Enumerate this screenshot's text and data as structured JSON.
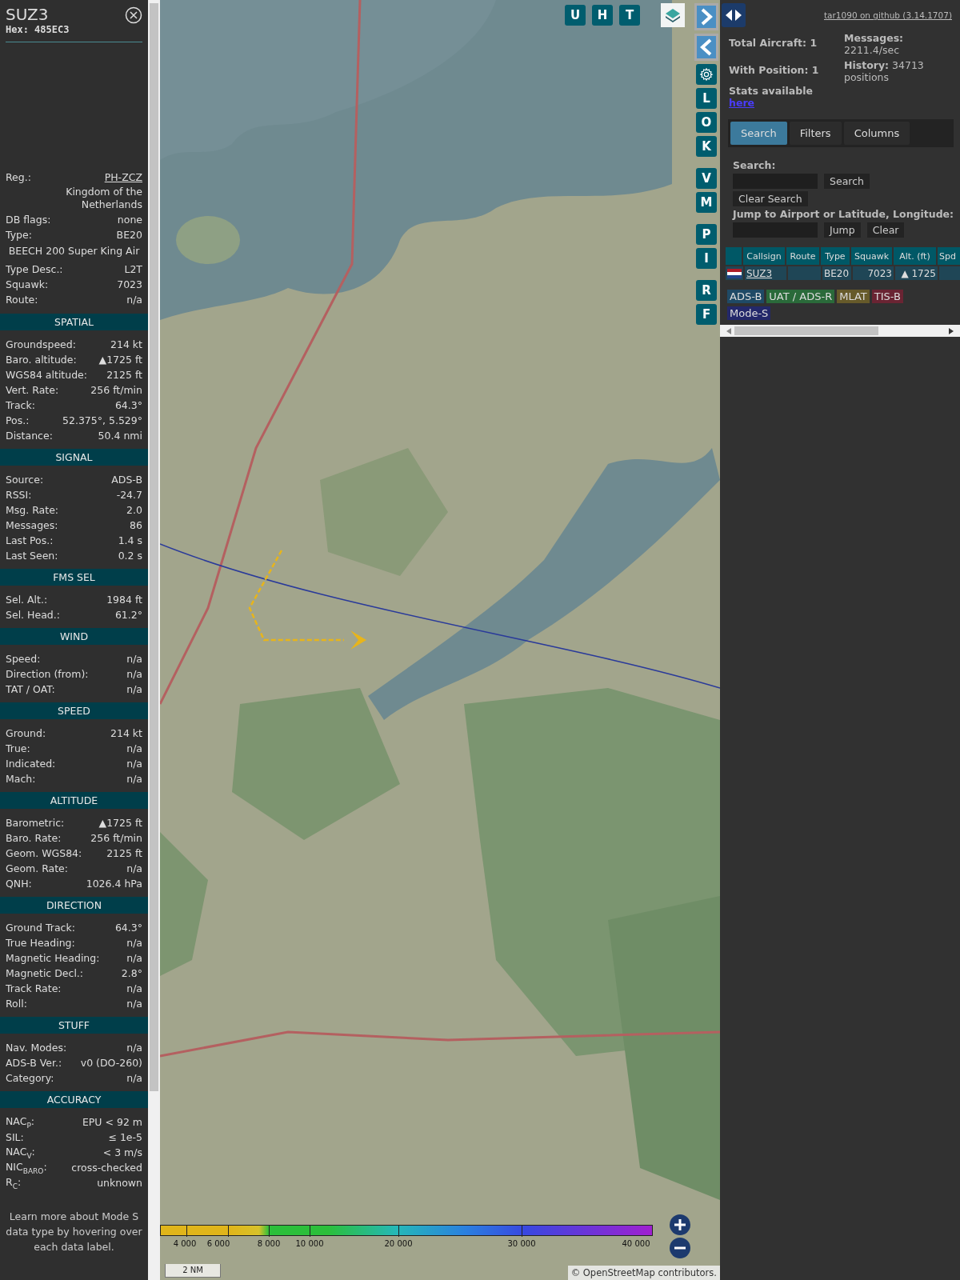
{
  "detail": {
    "callsign": "SUZ3",
    "hex": "Hex: 485EC3",
    "info": [
      {
        "kind": "link",
        "label": "Reg.:",
        "value": "PH-ZCZ"
      },
      {
        "kind": "note",
        "value": "Kingdom of the Netherlands"
      },
      {
        "kind": "pair",
        "label": "DB flags:",
        "value": "none"
      },
      {
        "kind": "pair",
        "label": "Type:",
        "value": "BE20"
      },
      {
        "kind": "full",
        "value": "BEECH 200 Super King Air"
      },
      {
        "kind": "pair",
        "label": "Type Desc.:",
        "value": "L2T"
      },
      {
        "kind": "pair",
        "label": "Squawk:",
        "value": "7023"
      },
      {
        "kind": "pair",
        "label": "Route:",
        "value": "n/a"
      }
    ],
    "sections": [
      {
        "title": "SPATIAL",
        "rows": [
          {
            "label": "Groundspeed:",
            "value": "214 kt"
          },
          {
            "label": "Baro. altitude:",
            "value": "▲1725 ft"
          },
          {
            "label": "WGS84 altitude:",
            "value": "2125 ft"
          },
          {
            "label": "Vert. Rate:",
            "value": "256 ft/min"
          },
          {
            "label": "Track:",
            "value": "64.3°"
          },
          {
            "label": "Pos.:",
            "value": "52.375°, 5.529°"
          },
          {
            "label": "Distance:",
            "value": "50.4 nmi"
          }
        ]
      },
      {
        "title": "SIGNAL",
        "rows": [
          {
            "label": "Source:",
            "value": "ADS-B"
          },
          {
            "label": "RSSI:",
            "value": "-24.7"
          },
          {
            "label": "Msg. Rate:",
            "value": "2.0"
          },
          {
            "label": "Messages:",
            "value": "86"
          },
          {
            "label": "Last Pos.:",
            "value": "1.4 s"
          },
          {
            "label": "Last Seen:",
            "value": "0.2 s"
          }
        ]
      },
      {
        "title": "FMS SEL",
        "rows": [
          {
            "label": "Sel. Alt.:",
            "value": "1984 ft"
          },
          {
            "label": "Sel. Head.:",
            "value": "61.2°"
          }
        ]
      },
      {
        "title": "WIND",
        "rows": [
          {
            "label": "Speed:",
            "value": "n/a"
          },
          {
            "label": "Direction (from):",
            "value": "n/a"
          },
          {
            "label": "TAT / OAT:",
            "value": "n/a"
          }
        ]
      },
      {
        "title": "SPEED",
        "rows": [
          {
            "label": "Ground:",
            "value": "214 kt"
          },
          {
            "label": "True:",
            "value": "n/a"
          },
          {
            "label": "Indicated:",
            "value": "n/a"
          },
          {
            "label": "Mach:",
            "value": "n/a"
          }
        ]
      },
      {
        "title": "ALTITUDE",
        "rows": [
          {
            "label": "Barometric:",
            "value": "▲1725 ft"
          },
          {
            "label": "Baro. Rate:",
            "value": "256 ft/min"
          },
          {
            "label": "Geom. WGS84:",
            "value": "2125 ft"
          },
          {
            "label": "Geom. Rate:",
            "value": "n/a"
          },
          {
            "label": "QNH:",
            "value": "1026.4 hPa"
          }
        ]
      },
      {
        "title": "DIRECTION",
        "rows": [
          {
            "label": "Ground Track:",
            "value": "64.3°"
          },
          {
            "label": "True Heading:",
            "value": "n/a"
          },
          {
            "label": "Magnetic Heading:",
            "value": "n/a"
          },
          {
            "label": "Magnetic Decl.:",
            "value": "2.8°"
          },
          {
            "label": "Track Rate:",
            "value": "n/a"
          },
          {
            "label": "Roll:",
            "value": "n/a"
          }
        ]
      },
      {
        "title": "STUFF",
        "rows": [
          {
            "label": "Nav. Modes:",
            "value": "n/a"
          },
          {
            "label": "ADS-B Ver.:",
            "value": "v0 (DO-260)"
          },
          {
            "label": "Category:",
            "value": "n/a"
          }
        ]
      },
      {
        "title": "ACCURACY",
        "rows": [
          {
            "label": "NAC$_{P}$:",
            "value": "EPU < 92 m"
          },
          {
            "label": "SIL:",
            "value": "≤ 1e-5"
          },
          {
            "label": "NAC$_{V}$:",
            "value": "< 3 m/s"
          },
          {
            "label": "NIC$_{BARO}$:",
            "value": "cross-checked"
          },
          {
            "label": "R$_{C}$:",
            "value": "unknown"
          }
        ]
      }
    ],
    "footer": "Learn more about Mode S data type by hovering over each data label."
  },
  "map": {
    "top_buttons": [
      "U",
      "H",
      "T"
    ],
    "side_groups": [
      [
        "L",
        "O",
        "K"
      ],
      [
        "V",
        "M"
      ],
      [
        "P",
        "I"
      ],
      [
        "R",
        "F"
      ]
    ],
    "legend": [
      "4 000",
      "6 000",
      "8 000",
      "10 000",
      "20 000",
      "30 000",
      "40 000"
    ],
    "scale": "2 NM",
    "attribution": {
      "prefix": "©",
      "link": "OpenStreetMap",
      "suffix": "contributors."
    }
  },
  "panel": {
    "version_link": "tar1090 on github (3.14.1707)",
    "stats_left": [
      "Total Aircraft: 1",
      "With Position: 1"
    ],
    "stats_note": "Stats available",
    "stats_link": "here",
    "stats_right": [
      {
        "label": "Messages:",
        "value": "2211.4/sec"
      },
      {
        "label": "History:",
        "value": "34713 positions"
      }
    ],
    "tabs": [
      {
        "label": "Search",
        "selected": true
      },
      {
        "label": "Filters",
        "selected": false
      },
      {
        "label": "Columns",
        "selected": false
      }
    ],
    "search": {
      "label": "Search:",
      "button": "Search",
      "clear_button": "Clear Search"
    },
    "jump": {
      "label": "Jump to Airport or Latitude, Longitude:",
      "button": "Jump",
      "clear_button": "Clear"
    },
    "table": {
      "columns": [
        "Callsign",
        "Route",
        "Type",
        "Squawk",
        "Alt. (ft)",
        "Spd"
      ],
      "rows": [
        {
          "callsign": "SUZ3",
          "type": "BE20",
          "squawk": "7023",
          "altitude": "▲ 1725"
        }
      ]
    },
    "sources": [
      {
        "label": "ADS-B",
        "color": "#1f4a66"
      },
      {
        "label": "UAT / ADS-R",
        "color": "#2a6a3a"
      },
      {
        "label": "MLAT",
        "color": "#665a2a"
      },
      {
        "label": "TIS-B",
        "color": "#6a2433"
      },
      {
        "label": "Mode-S",
        "color": "#23286a"
      }
    ]
  }
}
